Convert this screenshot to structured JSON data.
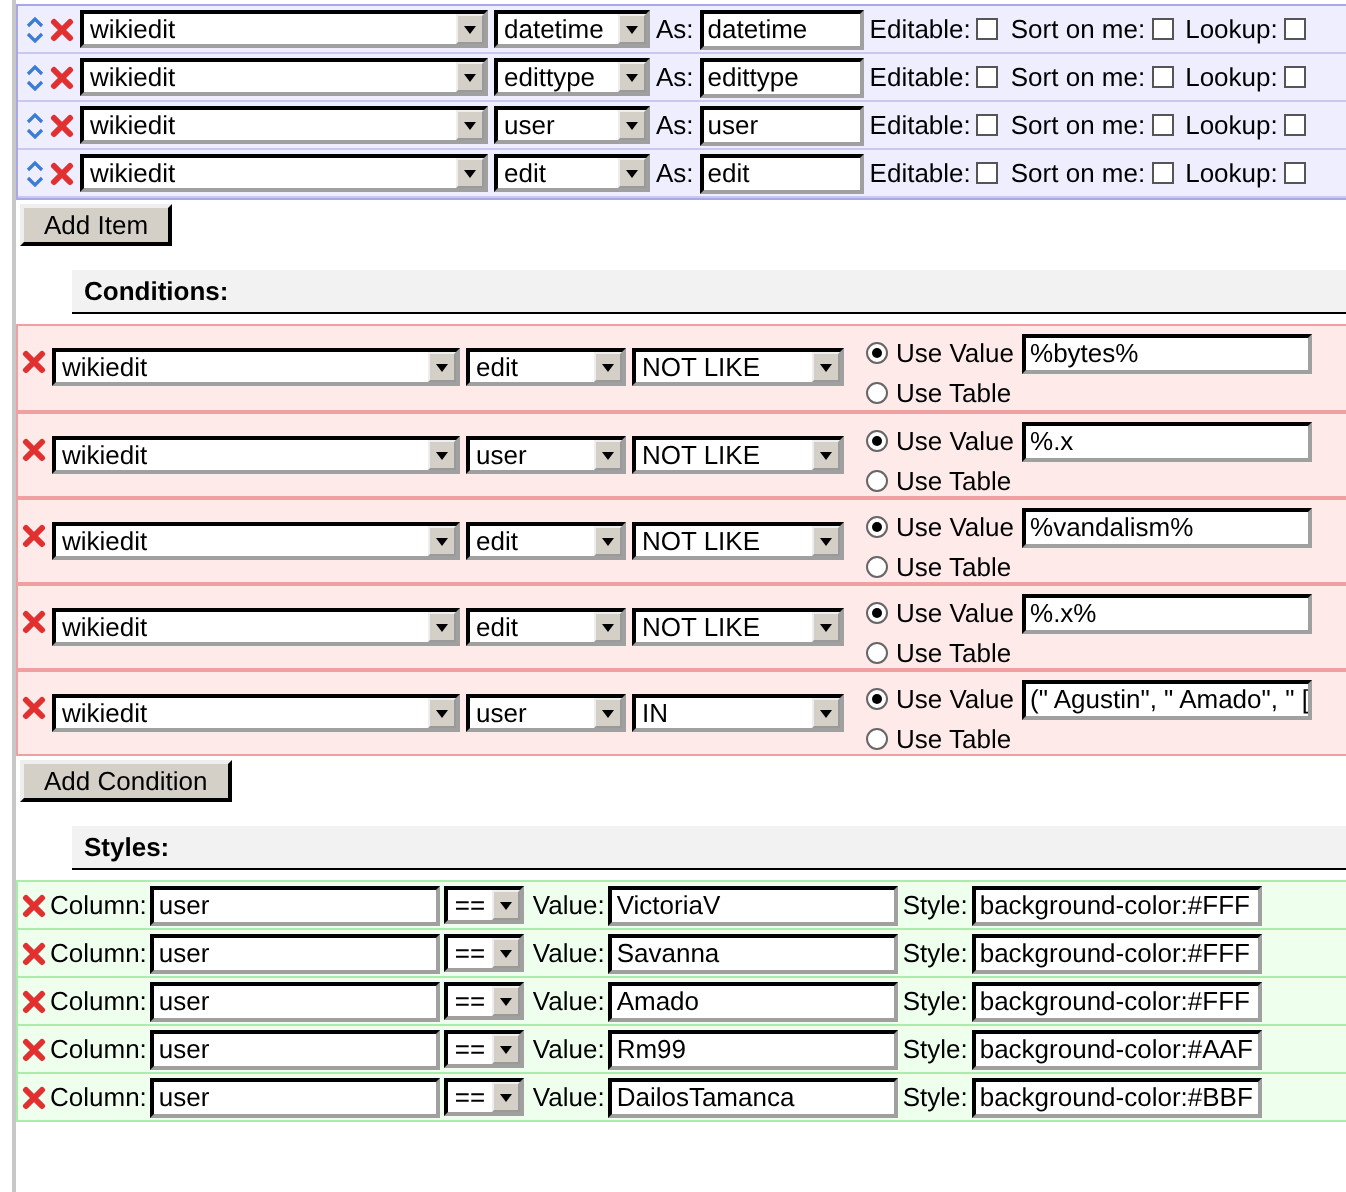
{
  "items": [
    {
      "table": "wikiedit",
      "field": "datetime",
      "as_label": "As:",
      "alias": "datetime",
      "editable_label": "Editable:",
      "editable": false,
      "sort_label": "Sort on me:",
      "sort": false,
      "lookup_label": "Lookup:",
      "lookup": false
    },
    {
      "table": "wikiedit",
      "field": "edittype",
      "as_label": "As:",
      "alias": "edittype",
      "editable_label": "Editable:",
      "editable": false,
      "sort_label": "Sort on me:",
      "sort": false,
      "lookup_label": "Lookup:",
      "lookup": false
    },
    {
      "table": "wikiedit",
      "field": "user",
      "as_label": "As:",
      "alias": "user",
      "editable_label": "Editable:",
      "editable": false,
      "sort_label": "Sort on me:",
      "sort": false,
      "lookup_label": "Lookup:",
      "lookup": false
    },
    {
      "table": "wikiedit",
      "field": "edit",
      "as_label": "As:",
      "alias": "edit",
      "editable_label": "Editable:",
      "editable": false,
      "sort_label": "Sort on me:",
      "sort": false,
      "lookup_label": "Lookup:",
      "lookup": false
    }
  ],
  "add_item_button": "Add Item",
  "conditions_heading": "Conditions:",
  "conditions": [
    {
      "table": "wikiedit",
      "field": "edit",
      "operator": "NOT LIKE",
      "use_value_label": "Use Value",
      "use_value_selected": true,
      "value": "%bytes%",
      "use_table_label": "Use Table",
      "use_table_selected": false
    },
    {
      "table": "wikiedit",
      "field": "user",
      "operator": "NOT LIKE",
      "use_value_label": "Use Value",
      "use_value_selected": true,
      "value": "%.x",
      "use_table_label": "Use Table",
      "use_table_selected": false
    },
    {
      "table": "wikiedit",
      "field": "edit",
      "operator": "NOT LIKE",
      "use_value_label": "Use Value",
      "use_value_selected": true,
      "value": "%vandalism%",
      "use_table_label": "Use Table",
      "use_table_selected": false
    },
    {
      "table": "wikiedit",
      "field": "edit",
      "operator": "NOT LIKE",
      "use_value_label": "Use Value",
      "use_value_selected": true,
      "value": "%.x%",
      "use_table_label": "Use Table",
      "use_table_selected": false
    },
    {
      "table": "wikiedit",
      "field": "user",
      "operator": "IN",
      "use_value_label": "Use Value",
      "use_value_selected": true,
      "value": "(\" Agustin\", \" Amado\", \" [",
      "use_table_label": "Use Table",
      "use_table_selected": false
    }
  ],
  "add_condition_button": "Add Condition",
  "styles_heading": "Styles:",
  "styles": [
    {
      "column_label": "Column:",
      "column": "user",
      "operator": "==",
      "value_label": "Value:",
      "value": "VictoriaV",
      "style_label": "Style:",
      "style": "background-color:#FFF"
    },
    {
      "column_label": "Column:",
      "column": "user",
      "operator": "==",
      "value_label": "Value:",
      "value": "Savanna",
      "style_label": "Style:",
      "style": "background-color:#FFF"
    },
    {
      "column_label": "Column:",
      "column": "user",
      "operator": "==",
      "value_label": "Value:",
      "value": "Amado",
      "style_label": "Style:",
      "style": "background-color:#FFF"
    },
    {
      "column_label": "Column:",
      "column": "user",
      "operator": "==",
      "value_label": "Value:",
      "value": "Rm99",
      "style_label": "Style:",
      "style": "background-color:#AAF"
    },
    {
      "column_label": "Column:",
      "column": "user",
      "operator": "==",
      "value_label": "Value:",
      "value": "DailosTamanca",
      "style_label": "Style:",
      "style": "background-color:#BBF"
    }
  ]
}
